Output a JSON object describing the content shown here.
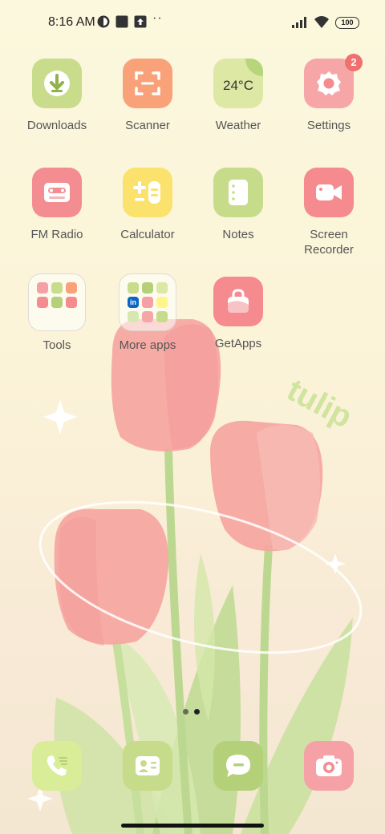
{
  "status_bar": {
    "time": "8:16 AM",
    "icons": [
      "carrier-app-icon",
      "square-notification-icon",
      "upload-notification-icon"
    ],
    "more_dots": "··",
    "battery": "100"
  },
  "wallpaper": {
    "text": "tulip"
  },
  "apps": [
    {
      "name": "downloads",
      "label": "Downloads",
      "color": "#c8dc8c"
    },
    {
      "name": "scanner",
      "label": "Scanner",
      "color": "#f9a27a"
    },
    {
      "name": "weather",
      "label": "Weather",
      "color": "#dce8a4",
      "temp": "24°C"
    },
    {
      "name": "settings",
      "label": "Settings",
      "color": "#f7a6a8",
      "badge": "2"
    },
    {
      "name": "fm-radio",
      "label": "FM Radio",
      "color": "#f38d92"
    },
    {
      "name": "calculator",
      "label": "Calculator",
      "color": "#fbe26c"
    },
    {
      "name": "notes",
      "label": "Notes",
      "color": "#c6dc8a"
    },
    {
      "name": "screen-recorder",
      "label": "Screen Recorder",
      "color": "#f58a8f"
    },
    {
      "name": "tools",
      "label": "Tools"
    },
    {
      "name": "more-apps",
      "label": "More apps"
    },
    {
      "name": "getapps",
      "label": "GetApps",
      "color": "#f58a8f"
    }
  ],
  "folder_mini_icons": {
    "more_apps_linkedin": "in"
  },
  "page_indicator": {
    "count": 2,
    "active": 1
  },
  "dock": [
    {
      "name": "phone",
      "color": "#d9ec98"
    },
    {
      "name": "contacts",
      "color": "#c6dc8a"
    },
    {
      "name": "messages",
      "color": "#b4d078"
    },
    {
      "name": "camera",
      "color": "#f5a1a6"
    }
  ]
}
